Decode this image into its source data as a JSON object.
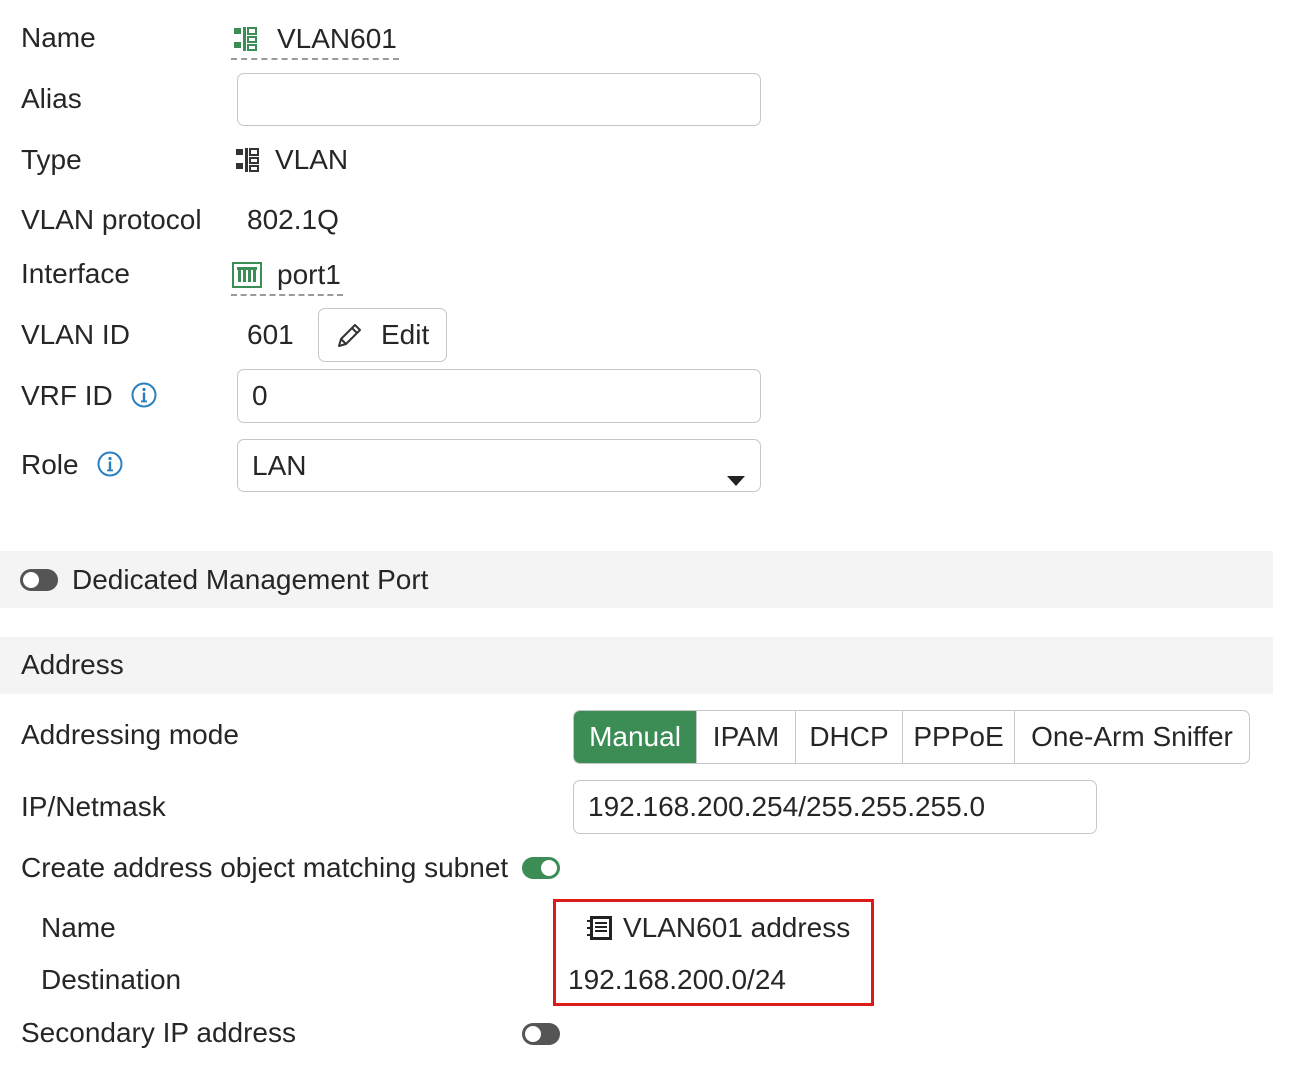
{
  "form": {
    "name_label": "Name",
    "name_value": "VLAN601",
    "alias_label": "Alias",
    "alias_value": "",
    "type_label": "Type",
    "type_value": "VLAN",
    "vlan_protocol_label": "VLAN protocol",
    "vlan_protocol_value": "802.1Q",
    "interface_label": "Interface",
    "interface_value": "port1",
    "vlan_id_label": "VLAN ID",
    "vlan_id_value": "601",
    "edit_label": "Edit",
    "vrf_id_label": "VRF ID",
    "vrf_id_value": "0",
    "role_label": "Role",
    "role_value": "LAN"
  },
  "dedicated_mgmt": {
    "label": "Dedicated Management Port",
    "enabled": false
  },
  "address": {
    "section_title": "Address",
    "addressing_mode_label": "Addressing mode",
    "modes": [
      "Manual",
      "IPAM",
      "DHCP",
      "PPPoE",
      "One-Arm Sniffer"
    ],
    "selected_mode": "Manual",
    "ip_netmask_label": "IP/Netmask",
    "ip_netmask_value": "192.168.200.254/255.255.255.0",
    "create_object_label": "Create address object matching subnet",
    "create_object_enabled": true,
    "object_name_label": "Name",
    "object_name_value": "VLAN601 address",
    "destination_label": "Destination",
    "destination_value": "192.168.200.0/24",
    "secondary_ip_label": "Secondary IP address",
    "secondary_ip_enabled": false
  },
  "colors": {
    "accent_green": "#3c8c55",
    "info_blue": "#2a7fbf",
    "highlight_red": "#dd1a1a",
    "section_bg": "#f4f4f4"
  },
  "icons": {
    "vlan": "vlan-icon",
    "port": "port-icon",
    "edit": "pencil-icon",
    "info": "info-icon",
    "address_object": "address-book-icon",
    "dropdown": "caret-down-icon"
  }
}
